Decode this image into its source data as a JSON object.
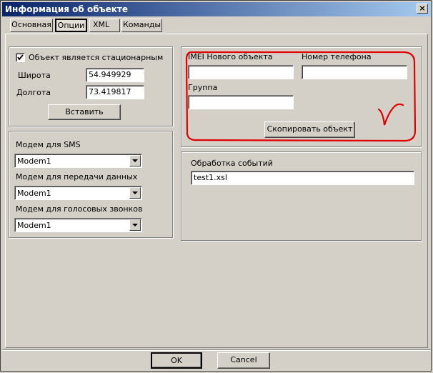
{
  "window": {
    "title": "Информация об объекте",
    "close_glyph": "×"
  },
  "tabs": [
    {
      "label": "Основная"
    },
    {
      "label": "Опции"
    },
    {
      "label": "XML"
    },
    {
      "label": "Команды"
    }
  ],
  "location": {
    "stationary_label": "Объект является стационарным",
    "stationary_checked": true,
    "latitude_label": "Широта",
    "latitude_value": "54.949929",
    "longitude_label": "Долгота",
    "longitude_value": "73.419817",
    "insert_button": "Вставить"
  },
  "modems": {
    "sms_label": "Модем для SMS",
    "sms_value": "Modem1",
    "data_label": "Модем для передачи данных",
    "data_value": "Modem1",
    "voice_label": "Модем для голосовых звонков",
    "voice_value": "Modem1"
  },
  "copy_object": {
    "imei_label": "IMEI Нового объекта",
    "imei_value": "",
    "phone_label": "Номер телефона",
    "phone_value": "",
    "group_label": "Группа",
    "group_value": "",
    "copy_button": "Скопировать объект",
    "annotation_color": "#e00000"
  },
  "events": {
    "label": "Обработка событий",
    "value": "test1.xsl"
  },
  "footer": {
    "ok": "OK",
    "cancel": "Cancel"
  }
}
